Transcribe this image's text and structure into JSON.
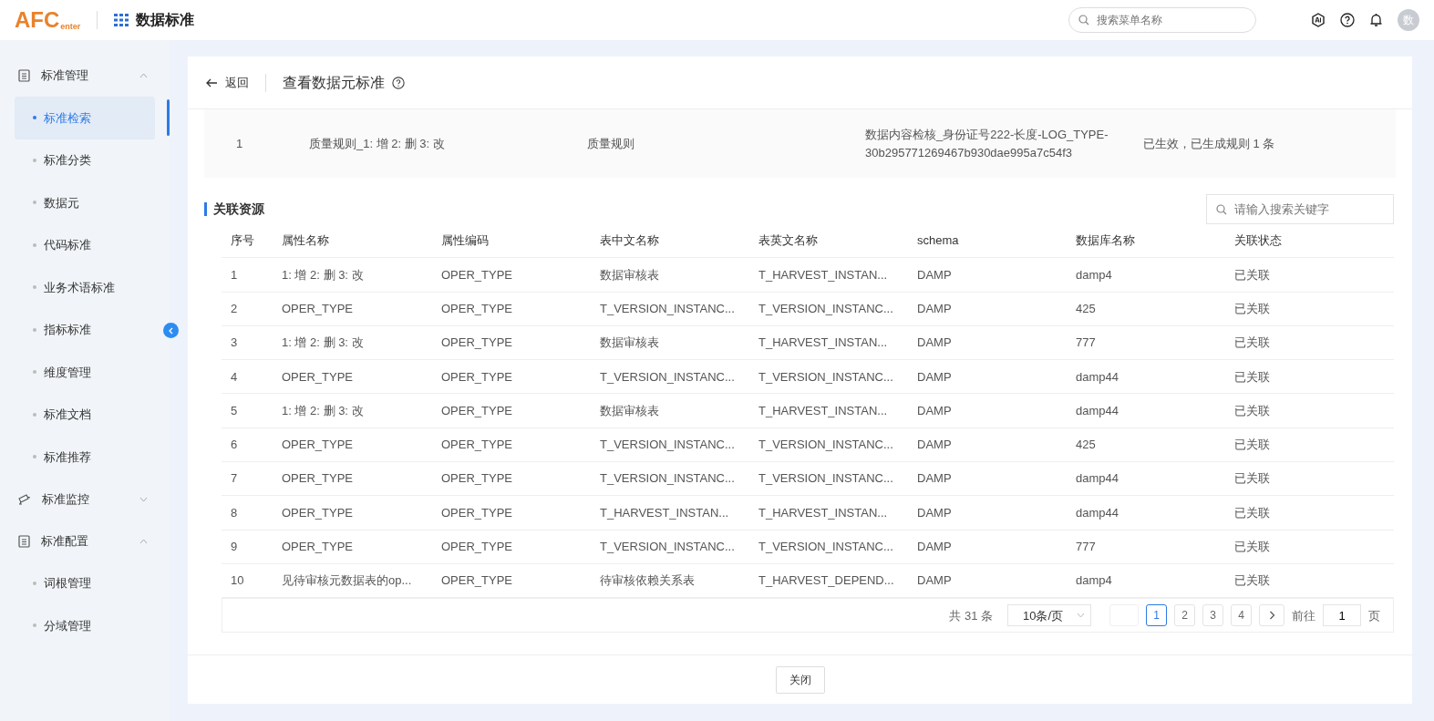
{
  "header": {
    "logo_main": "AFC",
    "logo_sub": "enter",
    "app_title": "数据标准",
    "search": {
      "placeholder": "搜索菜单名称"
    },
    "avatar": "数"
  },
  "sidebar": {
    "groups": [
      {
        "label": "标准管理",
        "expanded": true,
        "children": [
          {
            "label": "标准检索",
            "selected": true
          },
          {
            "label": "标准分类",
            "selected": false
          },
          {
            "label": "数据元",
            "selected": false
          },
          {
            "label": "代码标准",
            "selected": false
          },
          {
            "label": "业务术语标准",
            "selected": false
          },
          {
            "label": "指标标准",
            "selected": false
          },
          {
            "label": "维度管理",
            "selected": false
          },
          {
            "label": "标准文档",
            "selected": false
          },
          {
            "label": "标准推荐",
            "selected": false
          }
        ]
      },
      {
        "label": "标准监控",
        "expanded": false
      },
      {
        "label": "标准配置",
        "expanded": true,
        "children": [
          {
            "label": "词根管理",
            "selected": false
          },
          {
            "label": "分域管理",
            "selected": false
          }
        ]
      }
    ]
  },
  "page": {
    "back": "返回",
    "title": "查看数据元标准"
  },
  "rule_row": {
    "index": "1",
    "name": "质量规则_1: 增 2: 删 3: 改",
    "type": "质量规则",
    "detail": [
      "数据内容检核_身份证号222-长度-LOG_TYPE-",
      "30b295771269467b930dae995a7c54f3"
    ],
    "status": "已生效，已生成规则 1 条"
  },
  "resources": {
    "title": "关联资源",
    "search": {
      "placeholder": "请输入搜索关键字"
    },
    "columns": [
      "序号",
      "属性名称",
      "属性编码",
      "表中文名称",
      "表英文名称",
      "schema",
      "数据库名称",
      "关联状态"
    ],
    "rows": [
      [
        "1",
        "1: 增 2: 删 3: 改",
        "OPER_TYPE",
        "数据审核表",
        "T_HARVEST_INSTAN...",
        "DAMP",
        "damp4",
        "已关联"
      ],
      [
        "2",
        "OPER_TYPE",
        "OPER_TYPE",
        "T_VERSION_INSTANC...",
        "T_VERSION_INSTANC...",
        "DAMP",
        "425",
        "已关联"
      ],
      [
        "3",
        "1: 增 2: 删 3: 改",
        "OPER_TYPE",
        "数据审核表",
        "T_HARVEST_INSTAN...",
        "DAMP",
        "777",
        "已关联"
      ],
      [
        "4",
        "OPER_TYPE",
        "OPER_TYPE",
        "T_VERSION_INSTANC...",
        "T_VERSION_INSTANC...",
        "DAMP",
        "damp44",
        "已关联"
      ],
      [
        "5",
        "1: 增 2: 删 3: 改",
        "OPER_TYPE",
        "数据审核表",
        "T_HARVEST_INSTAN...",
        "DAMP",
        "damp44",
        "已关联"
      ],
      [
        "6",
        "OPER_TYPE",
        "OPER_TYPE",
        "T_VERSION_INSTANC...",
        "T_VERSION_INSTANC...",
        "DAMP",
        "425",
        "已关联"
      ],
      [
        "7",
        "OPER_TYPE",
        "OPER_TYPE",
        "T_VERSION_INSTANC...",
        "T_VERSION_INSTANC...",
        "DAMP",
        "damp44",
        "已关联"
      ],
      [
        "8",
        "OPER_TYPE",
        "OPER_TYPE",
        "T_HARVEST_INSTAN...",
        "T_HARVEST_INSTAN...",
        "DAMP",
        "damp44",
        "已关联"
      ],
      [
        "9",
        "OPER_TYPE",
        "OPER_TYPE",
        "T_VERSION_INSTANC...",
        "T_VERSION_INSTANC...",
        "DAMP",
        "777",
        "已关联"
      ],
      [
        "10",
        "见待审核元数据表的op...",
        "OPER_TYPE",
        "待审核依赖关系表",
        "T_HARVEST_DEPEND...",
        "DAMP",
        "damp4",
        "已关联"
      ]
    ],
    "pagination": {
      "total": "共 31 条",
      "page_size": "10条/页",
      "pages": [
        {
          "label": "1",
          "selected": true
        },
        {
          "label": "2",
          "selected": false
        },
        {
          "label": "3",
          "selected": false
        },
        {
          "label": "4",
          "selected": false
        }
      ],
      "goto_label": "前往",
      "goto_value": "1",
      "goto_suffix": "页"
    }
  },
  "footer": {
    "close": "关闭"
  }
}
